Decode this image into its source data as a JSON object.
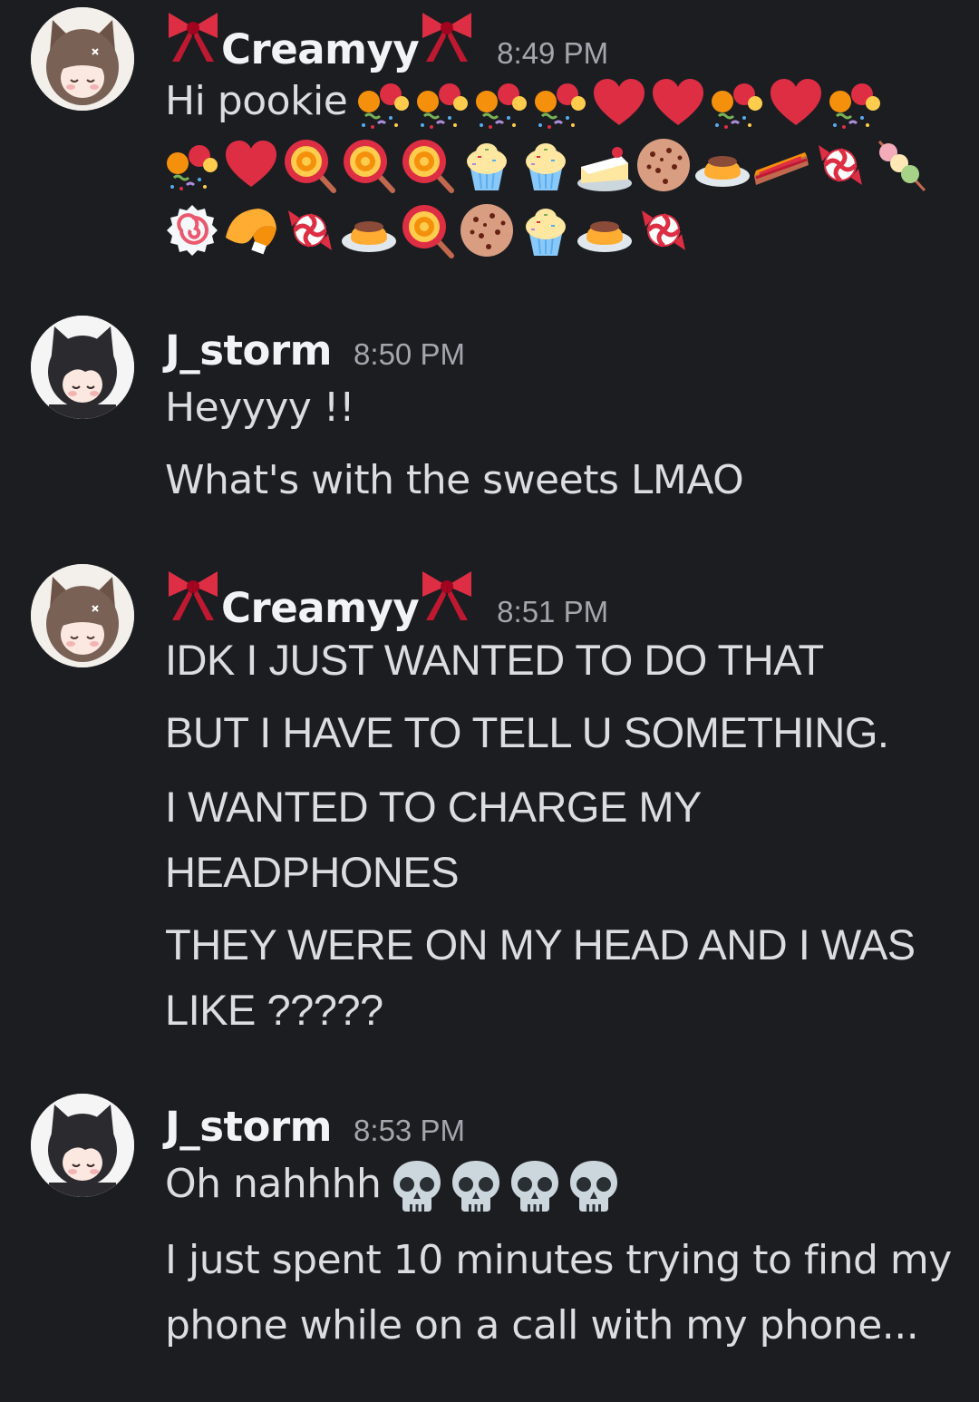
{
  "messages": [
    {
      "username": "Creamyy",
      "decoration": "ribbon-bow",
      "timestamp": "8:49 PM",
      "text": "Hi pookie",
      "inline_emojis": [
        "confetti-candy-icon",
        "confetti-candy-icon",
        "confetti-candy-icon",
        "confetti-candy-icon",
        "heart-icon",
        "heart-icon",
        "confetti-candy-icon",
        "heart-icon",
        "confetti-candy-icon"
      ],
      "emoji_rows": [
        [
          "confetti-candy-icon",
          "heart-icon",
          "lollipop-icon",
          "lollipop-icon",
          "lollipop-icon",
          "cupcake-icon",
          "cupcake-icon",
          "cake-slice-icon",
          "cookie-icon",
          "custard-icon",
          "pie-icon",
          "candy-icon",
          "dango-icon"
        ],
        [
          "fish-cake-icon",
          "fortune-cookie-icon",
          "candy-icon",
          "custard-icon",
          "lollipop-icon",
          "cookie-icon",
          "cupcake-icon",
          "custard-icon",
          "candy-icon"
        ]
      ]
    },
    {
      "username": "J_storm",
      "timestamp": "8:50 PM",
      "lines": [
        "Heyyyy !!",
        "What's with the sweets LMAO"
      ]
    },
    {
      "username": "Creamyy",
      "decoration": "ribbon-bow",
      "timestamp": "8:51 PM",
      "lines": [
        "IDK I JUST WANTED TO DO THAT",
        "BUT I HAVE TO TELL U SOMETHING.",
        "I WANTED TO CHARGE MY",
        "HEADPHONES",
        "THEY WERE ON MY HEAD AND I WAS",
        "LIKE ?????"
      ]
    },
    {
      "username": "J_storm",
      "timestamp": "8:53 PM",
      "text": "Oh nahhhh",
      "inline_emojis": [
        "skull-icon",
        "skull-icon",
        "skull-icon",
        "skull-icon"
      ],
      "lines": [
        "I just spent 10 minutes trying to find my",
        "phone while on a call with my phone..."
      ]
    }
  ],
  "colors": {
    "background": "#1c1d21",
    "username": "#f2f3f5",
    "timestamp": "#a3a6ad",
    "message_text": "#dcdde1",
    "ribbon": "#d8262d"
  }
}
